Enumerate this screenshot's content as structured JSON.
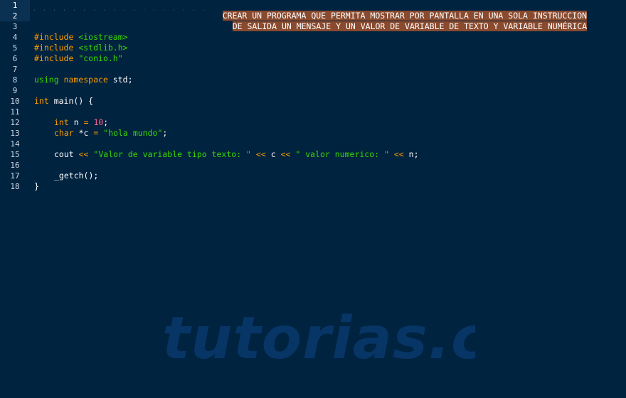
{
  "line_numbers": [
    "1",
    "2",
    "3",
    "4",
    "5",
    "6",
    "7",
    "8",
    "9",
    "10",
    "11",
    "12",
    "13",
    "14",
    "15",
    "16",
    "17",
    "18"
  ],
  "comment": {
    "line1": "CREAR UN PROGRAMA QUE PERMITA MOSTRAR POR PANTALLA EN UNA SOLA INSTRUCCION",
    "line2": "DE SALIDA UN MENSAJE Y UN VALOR DE VARIABLE DE TEXTO Y VARIABLE NUMÉRICA"
  },
  "code": {
    "inc_kw": "#include",
    "inc1": "<iostream>",
    "inc2": "<stdlib.h>",
    "inc3": "\"conio.h\"",
    "using": "using",
    "namespace": "namespace",
    "std": " std;",
    "int_kw": "int",
    "main_sig": " main() {",
    "n_decl_pre": " n ",
    "eq": "=",
    "ten": "10",
    "semi": ";",
    "char_kw": "char",
    "c_ptr": " *c ",
    "hola": "\"hola mundo\"",
    "cout": "cout ",
    "ltlt": "<<",
    "str1": "\"Valor de variable tipo texto: \"",
    "c_var": " c ",
    "str2": "\" valor numerico: \"",
    "n_end": " n;",
    "getch": "_getch();",
    "close": "}"
  },
  "watermark": "tutorias.co",
  "colors": {
    "background": "#00233f",
    "keyword": "#ff9d00",
    "string": "#3ad900",
    "number": "#ff628c",
    "selection": "#8a4a2e"
  }
}
